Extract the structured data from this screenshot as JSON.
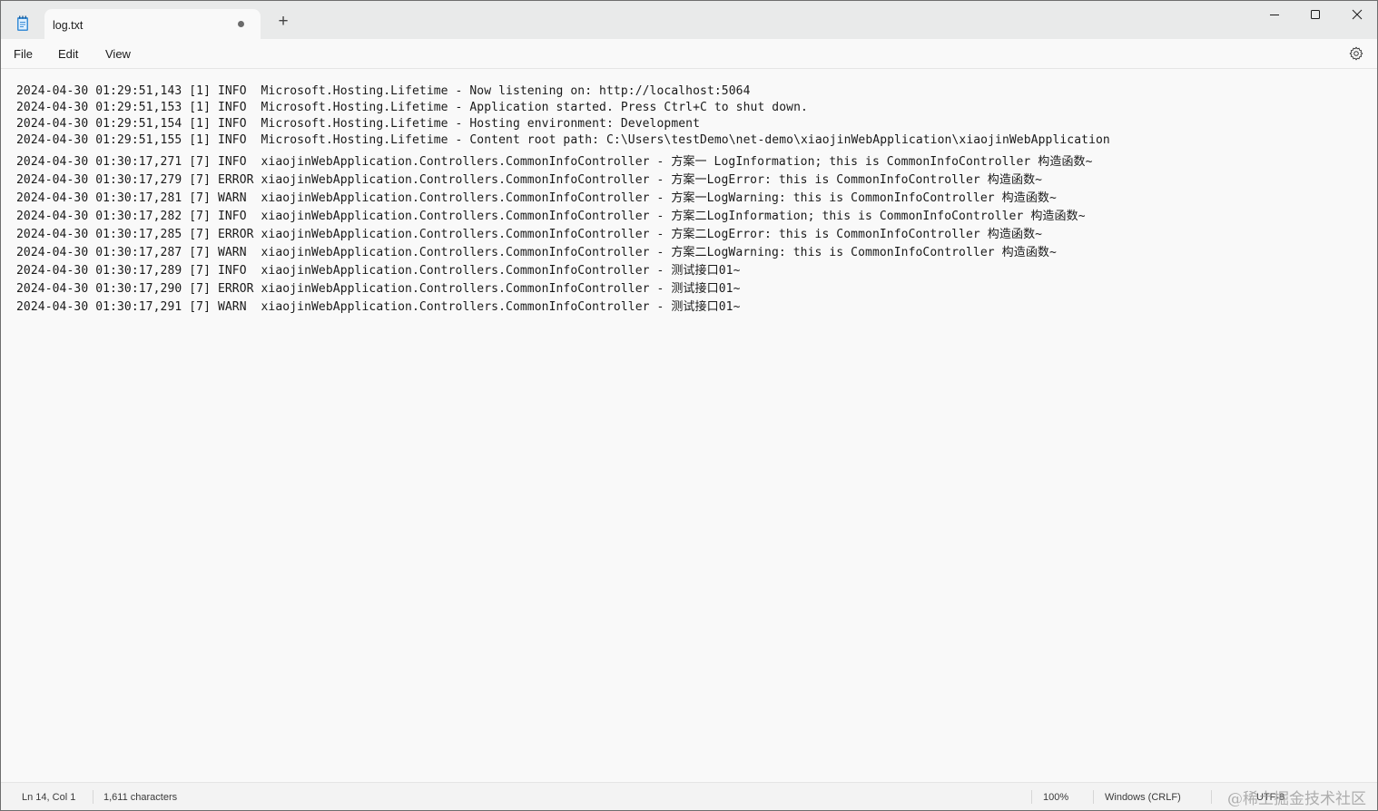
{
  "tab": {
    "title": "log.txt",
    "new_tab_label": "+"
  },
  "menu": {
    "file": "File",
    "edit": "Edit",
    "view": "View"
  },
  "icons": {
    "app": "notepad-icon",
    "unsaved": "unsaved-dot-icon",
    "minimize": "minimize-icon",
    "maximize": "maximize-icon",
    "close": "close-icon",
    "settings": "gear-icon"
  },
  "editor": {
    "lines": [
      "2024-04-30 01:29:51,143 [1] INFO  Microsoft.Hosting.Lifetime - Now listening on: http://localhost:5064",
      "2024-04-30 01:29:51,153 [1] INFO  Microsoft.Hosting.Lifetime - Application started. Press Ctrl+C to shut down.",
      "2024-04-30 01:29:51,154 [1] INFO  Microsoft.Hosting.Lifetime - Hosting environment: Development",
      "2024-04-30 01:29:51,155 [1] INFO  Microsoft.Hosting.Lifetime - Content root path: C:\\Users\\testDemo\\net-demo\\xiaojinWebApplication\\xiaojinWebApplication",
      "2024-04-30 01:30:17,271 [7] INFO  xiaojinWebApplication.Controllers.CommonInfoController - 方案一 LogInformation; this is CommonInfoController 构造函数~",
      "2024-04-30 01:30:17,279 [7] ERROR xiaojinWebApplication.Controllers.CommonInfoController - 方案一LogError: this is CommonInfoController 构造函数~",
      "2024-04-30 01:30:17,281 [7] WARN  xiaojinWebApplication.Controllers.CommonInfoController - 方案一LogWarning: this is CommonInfoController 构造函数~",
      "2024-04-30 01:30:17,282 [7] INFO  xiaojinWebApplication.Controllers.CommonInfoController - 方案二LogInformation; this is CommonInfoController 构造函数~",
      "2024-04-30 01:30:17,285 [7] ERROR xiaojinWebApplication.Controllers.CommonInfoController - 方案二LogError: this is CommonInfoController 构造函数~",
      "2024-04-30 01:30:17,287 [7] WARN  xiaojinWebApplication.Controllers.CommonInfoController - 方案二LogWarning: this is CommonInfoController 构造函数~",
      "2024-04-30 01:30:17,289 [7] INFO  xiaojinWebApplication.Controllers.CommonInfoController - 测试接口01~",
      "2024-04-30 01:30:17,290 [7] ERROR xiaojinWebApplication.Controllers.CommonInfoController - 测试接口01~",
      "2024-04-30 01:30:17,291 [7] WARN  xiaojinWebApplication.Controllers.CommonInfoController - 测试接口01~"
    ]
  },
  "status": {
    "position": "Ln 14, Col 1",
    "characters": "1,611 characters",
    "zoom": "100%",
    "line_ending": "Windows (CRLF)",
    "encoding": "UTF-8"
  },
  "watermark": "@稀土掘金技术社区"
}
